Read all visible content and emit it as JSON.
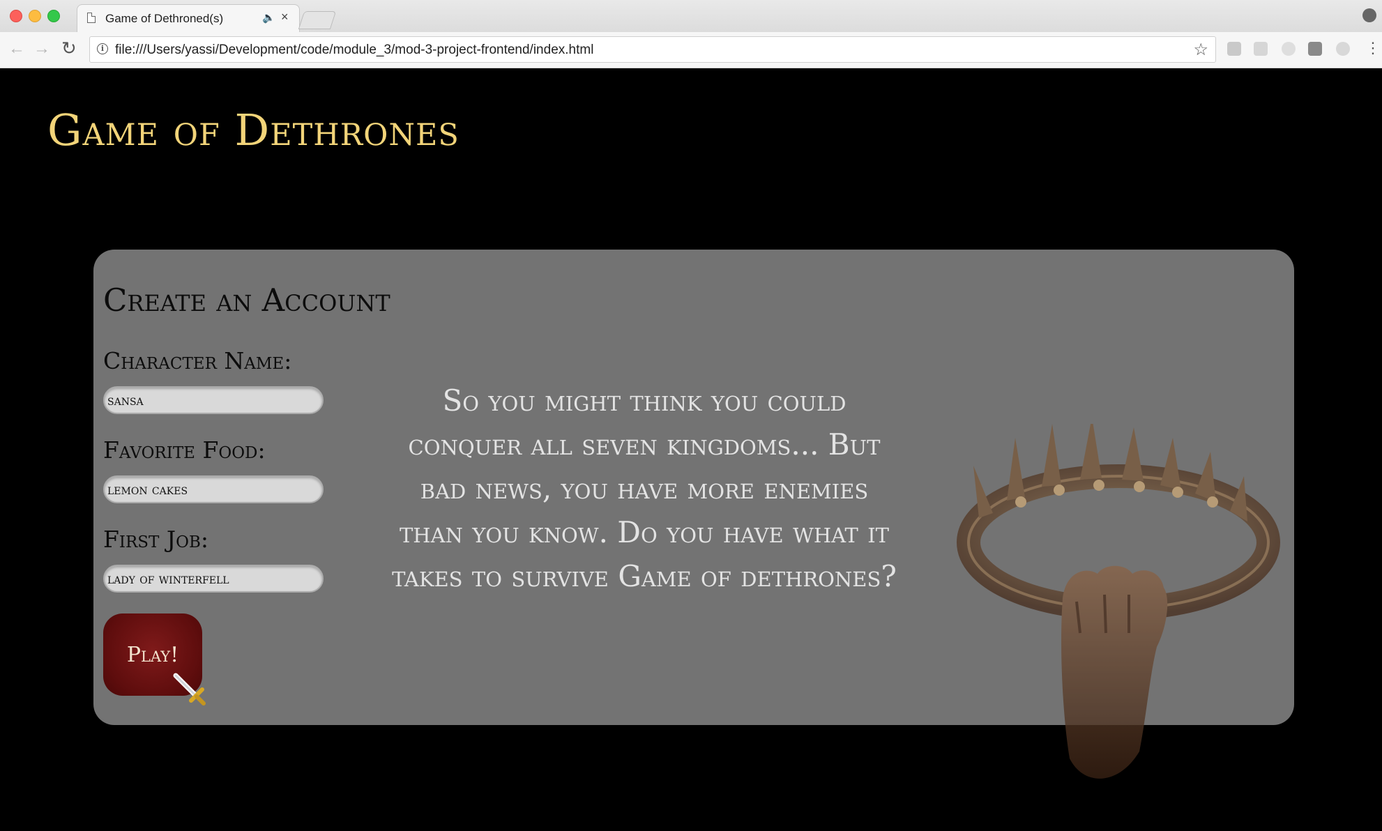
{
  "browser": {
    "tab_title": "Game of Dethroned(s)",
    "tab_close": "×",
    "tab_audio": "🔈",
    "url": "file:///Users/yassi/Development/code/module_3/mod-3-project-frontend/index.html",
    "info": "i",
    "star": "☆",
    "back": "←",
    "forward": "→",
    "reload": "↻",
    "menu": "⋮",
    "icons": [
      "page-icon",
      "audio-icon",
      "close-icon",
      "back-arrow-icon",
      "forward-arrow-icon",
      "reload-icon",
      "info-icon",
      "star-icon",
      "extension-icon",
      "menu-icon",
      "profile-icon"
    ]
  },
  "page": {
    "title": "Game of Dethrones",
    "colors": {
      "title": "#f2d479",
      "panel": "#737373",
      "button": "#5e0d0d"
    }
  },
  "form": {
    "heading": "Create an Account",
    "fields": [
      {
        "label": "Character Name:",
        "value": "sansa"
      },
      {
        "label": "Favorite Food:",
        "value": "lemon cakes"
      },
      {
        "label": "First Job:",
        "value": "lady of winterfell"
      }
    ],
    "submit_label": "Play!"
  },
  "intro": {
    "text": "So you might think you could conquer all seven kingdoms... But bad news, you have more enemies than you know. Do you have what it takes to survive Game of dethrones?"
  }
}
